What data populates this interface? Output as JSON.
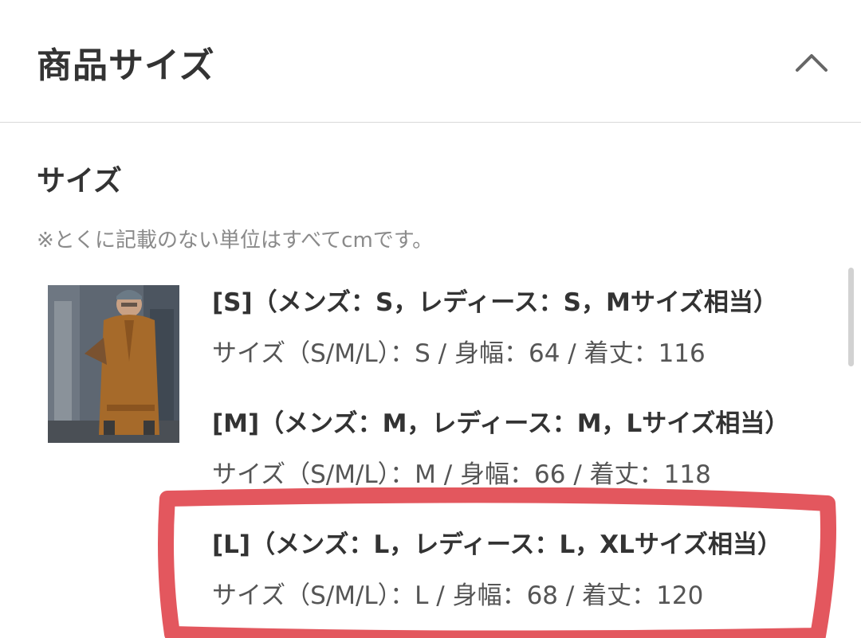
{
  "header": {
    "title": "商品サイズ",
    "collapse_icon": "chevron-up-icon"
  },
  "section": {
    "title": "サイズ",
    "note": "※とくに記載のない単位はすべてcmです。"
  },
  "sizes": [
    {
      "heading": "[S]（メンズ：S，レディース：S，Mサイズ相当）",
      "detail": "サイズ（S/M/L）：S / 身幅：64 / 着丈：116"
    },
    {
      "heading": "[M]（メンズ：M，レディース：M，Lサイズ相当）",
      "detail": "サイズ（S/M/L）：M / 身幅：66 / 着丈：118"
    },
    {
      "heading": "[L]（メンズ：L，レディース：L，XLサイズ相当）",
      "detail": "サイズ（S/M/L）：L / 身幅：68 / 着丈：120"
    }
  ],
  "colors": {
    "highlight": "#e0454d",
    "divider": "#d9d9d9",
    "text": "#333333",
    "note": "#8a8a8a"
  }
}
